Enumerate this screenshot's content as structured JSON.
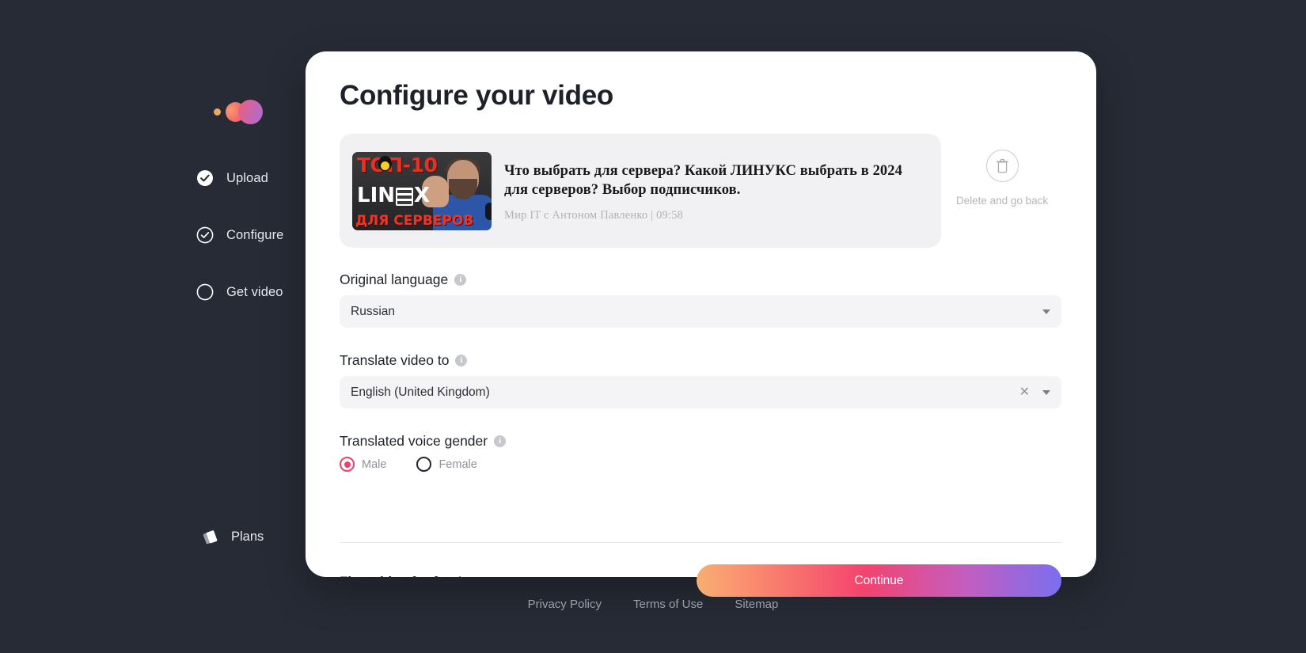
{
  "theme": {
    "background": "#262b35",
    "dialog_background": "#ffffff",
    "accent_pink": "#ef3e6b",
    "card_background": "#f1f1f3"
  },
  "sidebar": {
    "logo_name": "app-logo",
    "items": [
      {
        "label": "Upload",
        "icon": "check-circle-filled-icon",
        "state": "completed"
      },
      {
        "label": "Configure",
        "icon": "check-circle-outline-icon",
        "state": "active"
      },
      {
        "label": "Get video",
        "icon": "empty-circle-icon",
        "state": "pending"
      }
    ],
    "plans": {
      "label": "Plans",
      "icon": "cards-icon"
    }
  },
  "dialog": {
    "title": "Configure your video",
    "video": {
      "title": "Что выбрать для сервера? Какой ЛИНУКС выбрать в 2024 для серверов? Выбор подписчиков.",
      "channel_and_duration": "Мир IT с Антоном Павленко | 09:58",
      "thumbnail": {
        "top_text": "ТОП-10",
        "mid_text": "LIN",
        "mid_text_end": "X",
        "bottom_text": "ДЛЯ СЕРВЕРОВ"
      }
    },
    "delete": {
      "icon": "trash-icon",
      "label": "Delete and go back"
    },
    "fields": {
      "original_language": {
        "label": "Original language",
        "info_icon": "info-icon",
        "value": "Russian",
        "caret_icon": "chevron-down-icon"
      },
      "translate_to": {
        "label": "Translate video to",
        "info_icon": "info-icon",
        "value": "English (United Kingdom)",
        "clear_icon": "close-icon",
        "caret_icon": "chevron-down-icon"
      },
      "voice_gender": {
        "label": "Translated voice gender",
        "info_icon": "info-icon",
        "options": [
          {
            "label": "Male",
            "selected": true
          },
          {
            "label": "Female",
            "selected": false
          }
        ]
      }
    },
    "footer": {
      "free_note": "First video for free!",
      "continue_label": "Continue"
    }
  },
  "page_footer": {
    "links": [
      {
        "label": "Privacy Policy"
      },
      {
        "label": "Terms of Use"
      },
      {
        "label": "Sitemap"
      }
    ]
  }
}
